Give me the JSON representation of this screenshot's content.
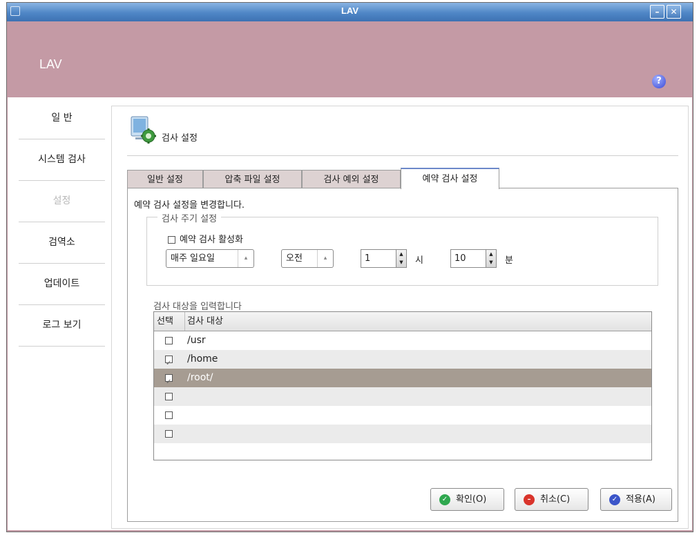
{
  "window": {
    "title": "LAV"
  },
  "header": {
    "brand": "LAV",
    "help_glyph": "?"
  },
  "sidebar": {
    "items": [
      {
        "label": "일 반"
      },
      {
        "label": "시스템 검사"
      },
      {
        "label": "설정",
        "state": "disabled"
      },
      {
        "label": "검역소"
      },
      {
        "label": "업데이트"
      },
      {
        "label": "로그 보기"
      }
    ]
  },
  "panel": {
    "title": "검사 설정",
    "tabs": [
      {
        "label": "일반 설정"
      },
      {
        "label": "압축 파일 설정"
      },
      {
        "label": "검사 예외 설정"
      },
      {
        "label": "예약 검사 설정",
        "active": true
      }
    ],
    "description": "예약 검사 설정을 변경합니다.",
    "schedule": {
      "legend": "검사 주기 설정",
      "enable_label": "예약 검사 활성화",
      "enable_checked": false,
      "day_value": "매주 일요일",
      "ampm_value": "오전",
      "hour_value": "1",
      "hour_unit": "시",
      "minute_value": "10",
      "minute_unit": "분"
    },
    "targets": {
      "label": "검사 대상을 입력합니다",
      "headers": {
        "select": "선택",
        "target": "검사 대상"
      },
      "rows": [
        {
          "checked": false,
          "path": "/usr"
        },
        {
          "checked": true,
          "path": "/home"
        },
        {
          "checked": true,
          "path": "/root/",
          "selected": true
        },
        {
          "checked": false,
          "path": ""
        },
        {
          "checked": false,
          "path": ""
        },
        {
          "checked": false,
          "path": ""
        }
      ]
    }
  },
  "buttons": {
    "ok": "확인(O)",
    "cancel": "취소(C)",
    "apply": "적용(A)"
  },
  "colors": {
    "accent_band": "#c49aa5",
    "titlebar": "#4f86c6",
    "selected_row": "#a69c92",
    "ok_icon": "#2fa84f",
    "cancel_icon": "#d9342b",
    "apply_icon": "#3b55c9"
  }
}
